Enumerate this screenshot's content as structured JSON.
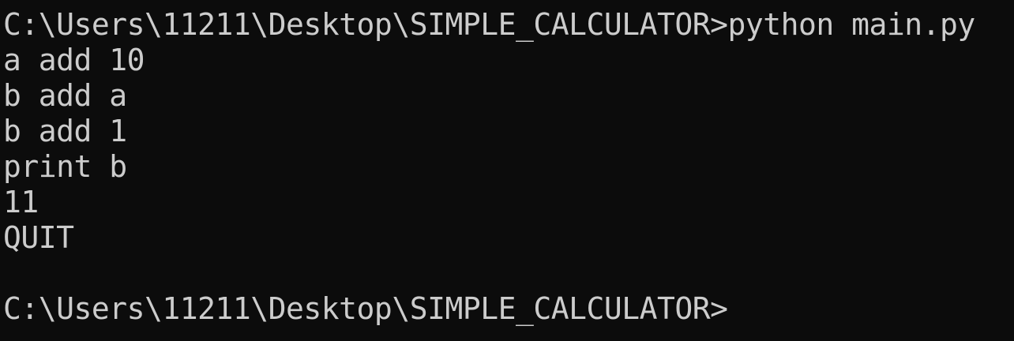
{
  "console": {
    "lines": [
      "C:\\Users\\11211\\Desktop\\SIMPLE_CALCULATOR>python main.py",
      "a add 10",
      "b add a",
      "b add 1",
      "print b",
      "11",
      "QUIT",
      "",
      "C:\\Users\\11211\\Desktop\\SIMPLE_CALCULATOR>"
    ]
  },
  "colors": {
    "background": "#0c0c0c",
    "foreground": "#cccccc"
  }
}
